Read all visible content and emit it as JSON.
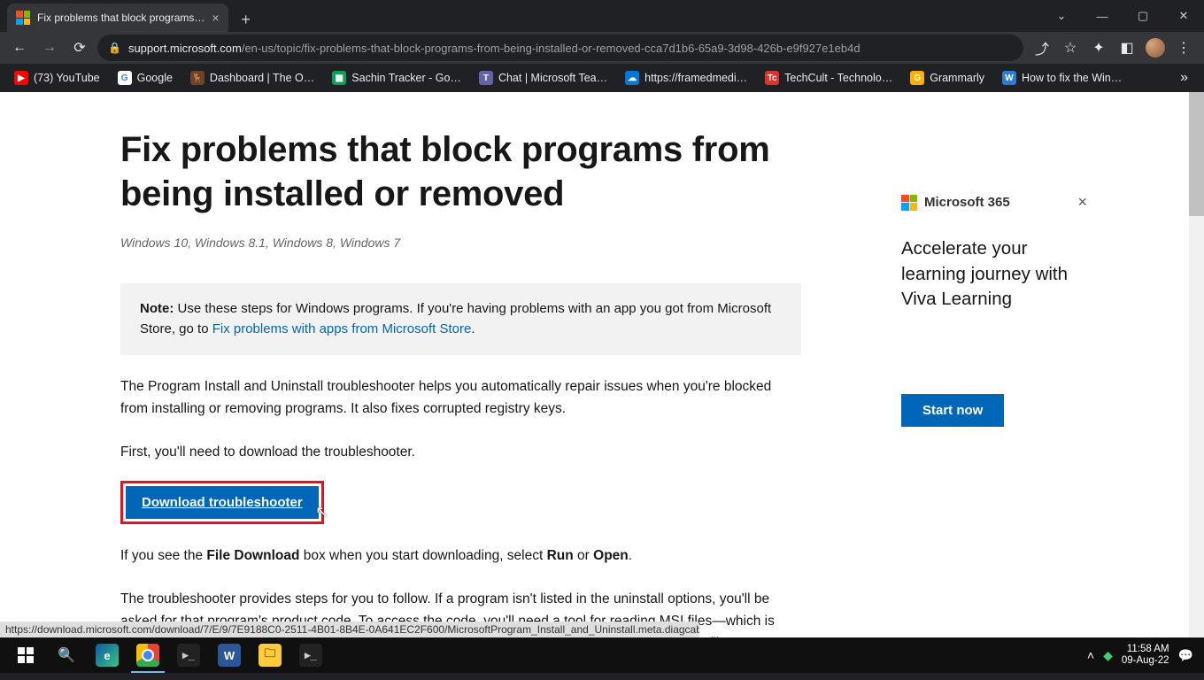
{
  "browser": {
    "tab": {
      "title": "Fix problems that block programs…"
    },
    "url_host": "support.microsoft.com",
    "url_path": "/en-us/topic/fix-problems-that-block-programs-from-being-installed-or-removed-cca7d1b6-65a9-3d98-426b-e9f927e1eb4d",
    "bookmarks": [
      {
        "label": "(73) YouTube",
        "color": "#ff0000",
        "glyph": "▶"
      },
      {
        "label": "Google",
        "color": "#ffffff",
        "glyph": "G"
      },
      {
        "label": "Dashboard | The O…",
        "color": "#6b4423",
        "glyph": "🦌"
      },
      {
        "label": "Sachin Tracker - Go…",
        "color": "#0f9d58",
        "glyph": "▦"
      },
      {
        "label": "Chat | Microsoft Tea…",
        "color": "#6264a7",
        "glyph": "T"
      },
      {
        "label": "https://framedmedi…",
        "color": "#0078d4",
        "glyph": "☁"
      },
      {
        "label": "TechCult - Technolo…",
        "color": "#e03131",
        "glyph": "Tc"
      },
      {
        "label": "Grammarly",
        "color": "#ffb000",
        "glyph": "G"
      },
      {
        "label": "How to fix the Win…",
        "color": "#2b7cd3",
        "glyph": "W"
      }
    ]
  },
  "page": {
    "heading": "Fix problems that block programs from being installed or removed",
    "applies_to": "Windows 10, Windows 8.1, Windows 8, Windows 7",
    "note_prefix": "Note:",
    "note_text_before": " Use these steps for Windows programs. If you're having problems with an app you got from Microsoft Store, go to ",
    "note_link": "Fix problems with apps from Microsoft Store",
    "p1": "The Program Install and Uninstall troubleshooter helps you automatically repair issues when you're blocked from installing or removing programs. It also fixes corrupted registry keys.",
    "p2": "First, you'll need to download the troubleshooter.",
    "download_btn": "Download troubleshooter",
    "p3_a": "If you see the ",
    "p3_b": "File Download",
    "p3_c": " box when you start downloading, select ",
    "p3_d": "Run",
    "p3_e": " or ",
    "p3_f": "Open",
    "p3_g": ".",
    "p4": "The troubleshooter provides steps for you to follow. If a program isn't listed in the uninstall options, you'll be asked for that program's product code. To access the code, you'll need a tool for reading MSI files—which is typically available to IT professionals. You'll find the product code in the property table of the MSI file."
  },
  "sidebar": {
    "brand": "Microsoft 365",
    "headline": "Accelerate your learning journey with Viva Learning",
    "cta": "Start now"
  },
  "status_url": "https://download.microsoft.com/download/7/E/9/7E9188C0-2511-4B01-8B4E-0A641EC2F600/MicrosoftProgram_Install_and_Uninstall.meta.diagcab",
  "taskbar": {
    "time": "11:58 AM",
    "date": "09-Aug-22"
  }
}
